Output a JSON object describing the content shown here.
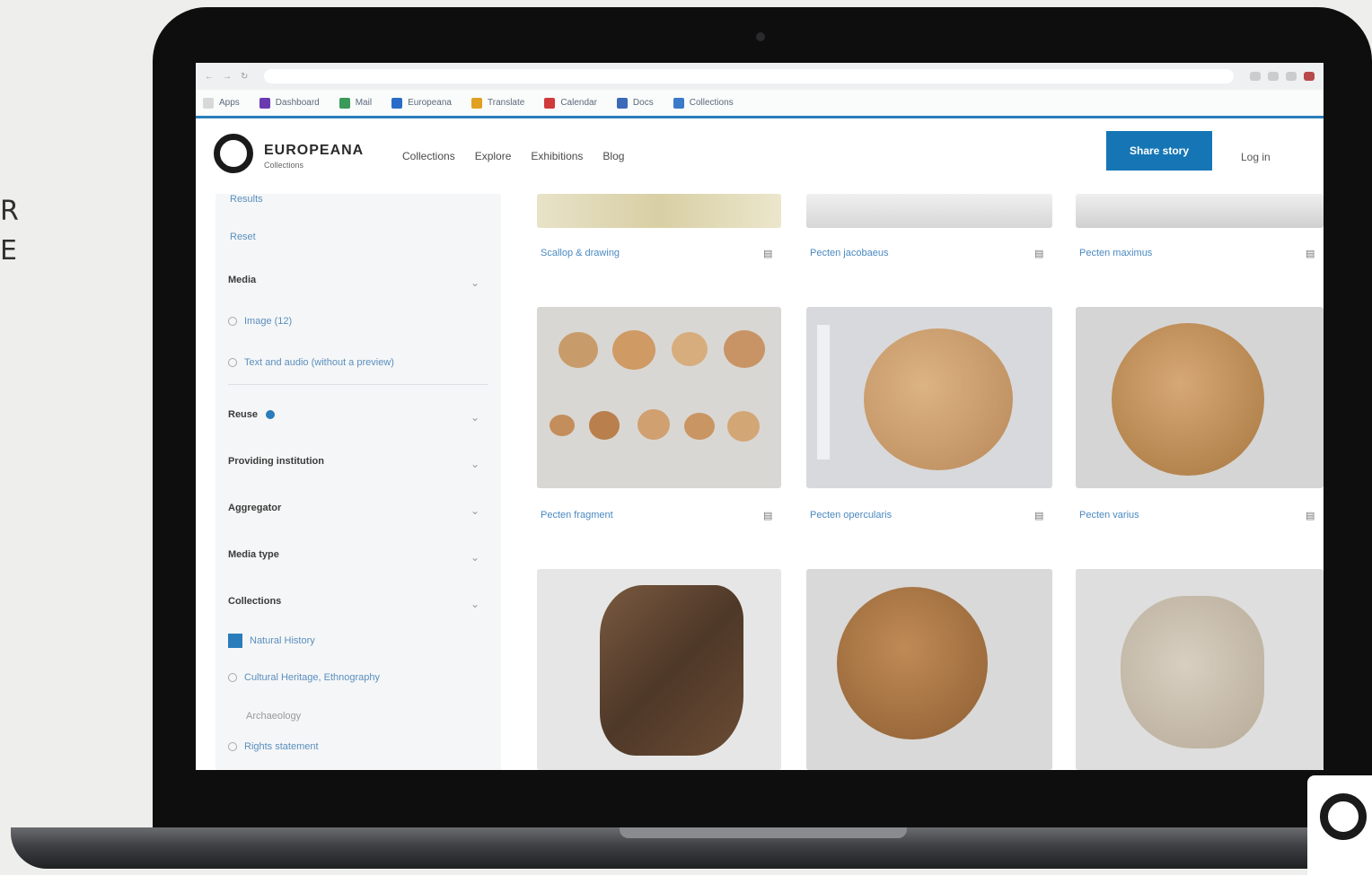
{
  "side_text": {
    "line1": "R",
    "line2": "E"
  },
  "browser": {
    "url": "",
    "bookmarks": [
      "Apps",
      "Dashboard",
      "Mail",
      "Europeana",
      "Translate",
      "Calendar",
      "Docs",
      "Collections"
    ]
  },
  "site": {
    "logo_name": "EUROPEANA",
    "logo_sub": "Collections",
    "nav": [
      "Collections",
      "Explore",
      "Exhibitions",
      "Blog"
    ],
    "primary_button": "Share story",
    "login_label": "Log in"
  },
  "sidebar": {
    "top_link": "Results",
    "sub_link": "Reset",
    "filter_title": "Media",
    "options": [
      "Image (12)",
      "Text and audio (without a preview)"
    ],
    "sections": [
      "Reuse",
      "Providing institution",
      "Aggregator",
      "Media type",
      "Collections"
    ],
    "selected": "Natural History",
    "other1": "Cultural Heritage, Ethnography",
    "other2": "Archaeology",
    "other3": "Rights statement"
  },
  "grid": {
    "row1": [
      "Scallop & drawing",
      "Pecten jacobaeus",
      "Pecten maximus"
    ],
    "row2": [
      "Pecten fragment",
      "Pecten opercularis",
      "Pecten varius"
    ]
  },
  "icons": {
    "share": "share-icon",
    "chevron": "chevron-down-icon",
    "camera": "camera-icon",
    "logo": "logo-icon"
  }
}
